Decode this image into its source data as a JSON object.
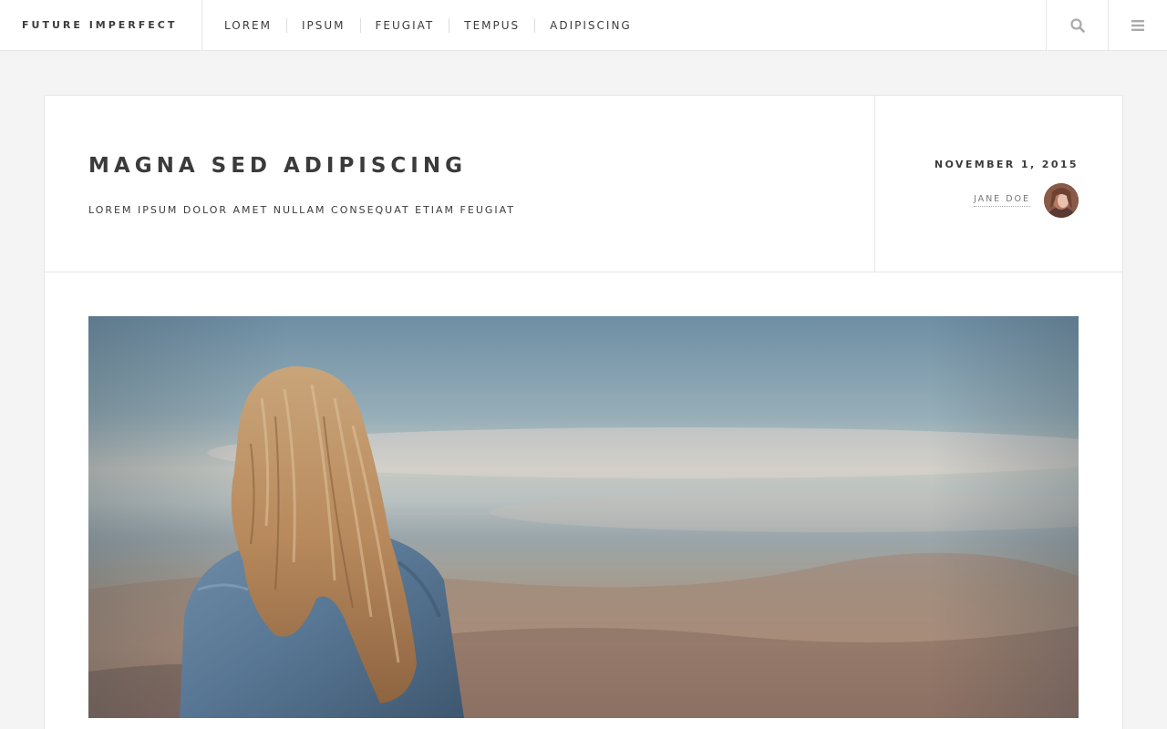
{
  "site": {
    "brand": "FUTURE IMPERFECT"
  },
  "nav": {
    "items": [
      "LOREM",
      "IPSUM",
      "FEUGIAT",
      "TEMPUS",
      "ADIPISCING"
    ]
  },
  "header_icons": {
    "search": "search-icon",
    "menu": "menu-icon"
  },
  "post": {
    "title": "MAGNA SED ADIPISCING",
    "subtitle": "LOREM IPSUM DOLOR AMET NULLAM CONSEQUAT ETIAM FEUGIAT",
    "date": "NOVEMBER 1, 2015",
    "author": "JANE DOE"
  },
  "colors": {
    "text": "#3c3b3b",
    "background": "#f4f4f4",
    "card": "#ffffff",
    "border": "#e6e6e6",
    "muted": "#777777"
  }
}
